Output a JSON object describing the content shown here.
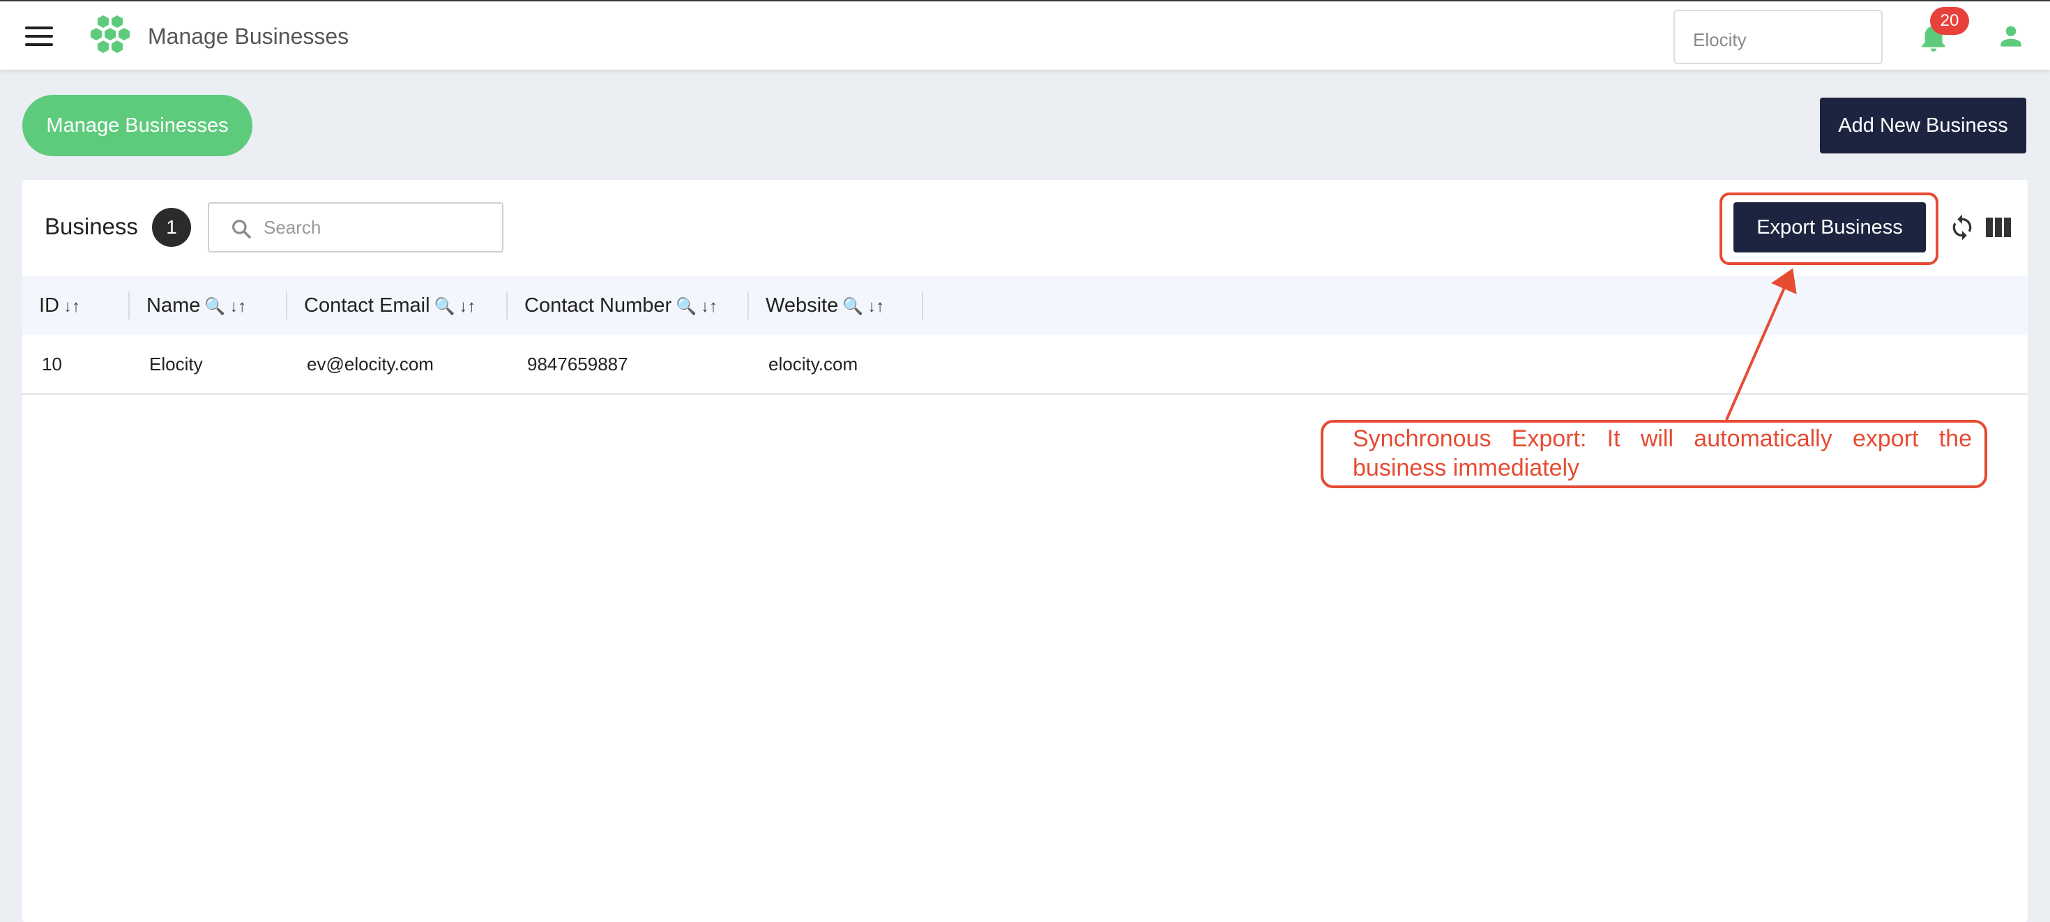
{
  "header": {
    "app_title": "Manage Businesses",
    "business_selector": "Elocity",
    "notification_count": "20",
    "menu_icon": "hamburger-icon",
    "logo_icon": "hexagon-cluster-logo",
    "bell_icon": "bell-icon",
    "user_icon": "user-icon"
  },
  "page": {
    "pill_label": "Manage Businesses",
    "add_button_label": "Add New Business"
  },
  "card": {
    "title": "Business",
    "count": "1",
    "search_placeholder": "Search",
    "export_button_label": "Export Business"
  },
  "table": {
    "columns": [
      {
        "label": "ID",
        "sort": "↓↑",
        "filter": ""
      },
      {
        "label": "Name",
        "sort": "↓↑",
        "filter": "🔍"
      },
      {
        "label": "Contact Email",
        "sort": "↓↑",
        "filter": "🔍"
      },
      {
        "label": "Contact Number",
        "sort": "↓↑",
        "filter": "🔍"
      },
      {
        "label": "Website",
        "sort": "↓↑",
        "filter": "🔍"
      }
    ],
    "rows": [
      {
        "id": "10",
        "name": "Elocity",
        "email": "ev@elocity.com",
        "number": "9847659887",
        "website": "elocity.com"
      }
    ]
  },
  "annotation": {
    "text": "Synchronous Export: It will automatically export the business immediately"
  },
  "colors": {
    "accent_green": "#5ecb7c",
    "navy": "#1c2440",
    "annotation_red": "#e64b33",
    "badge_red": "#e8413b"
  }
}
